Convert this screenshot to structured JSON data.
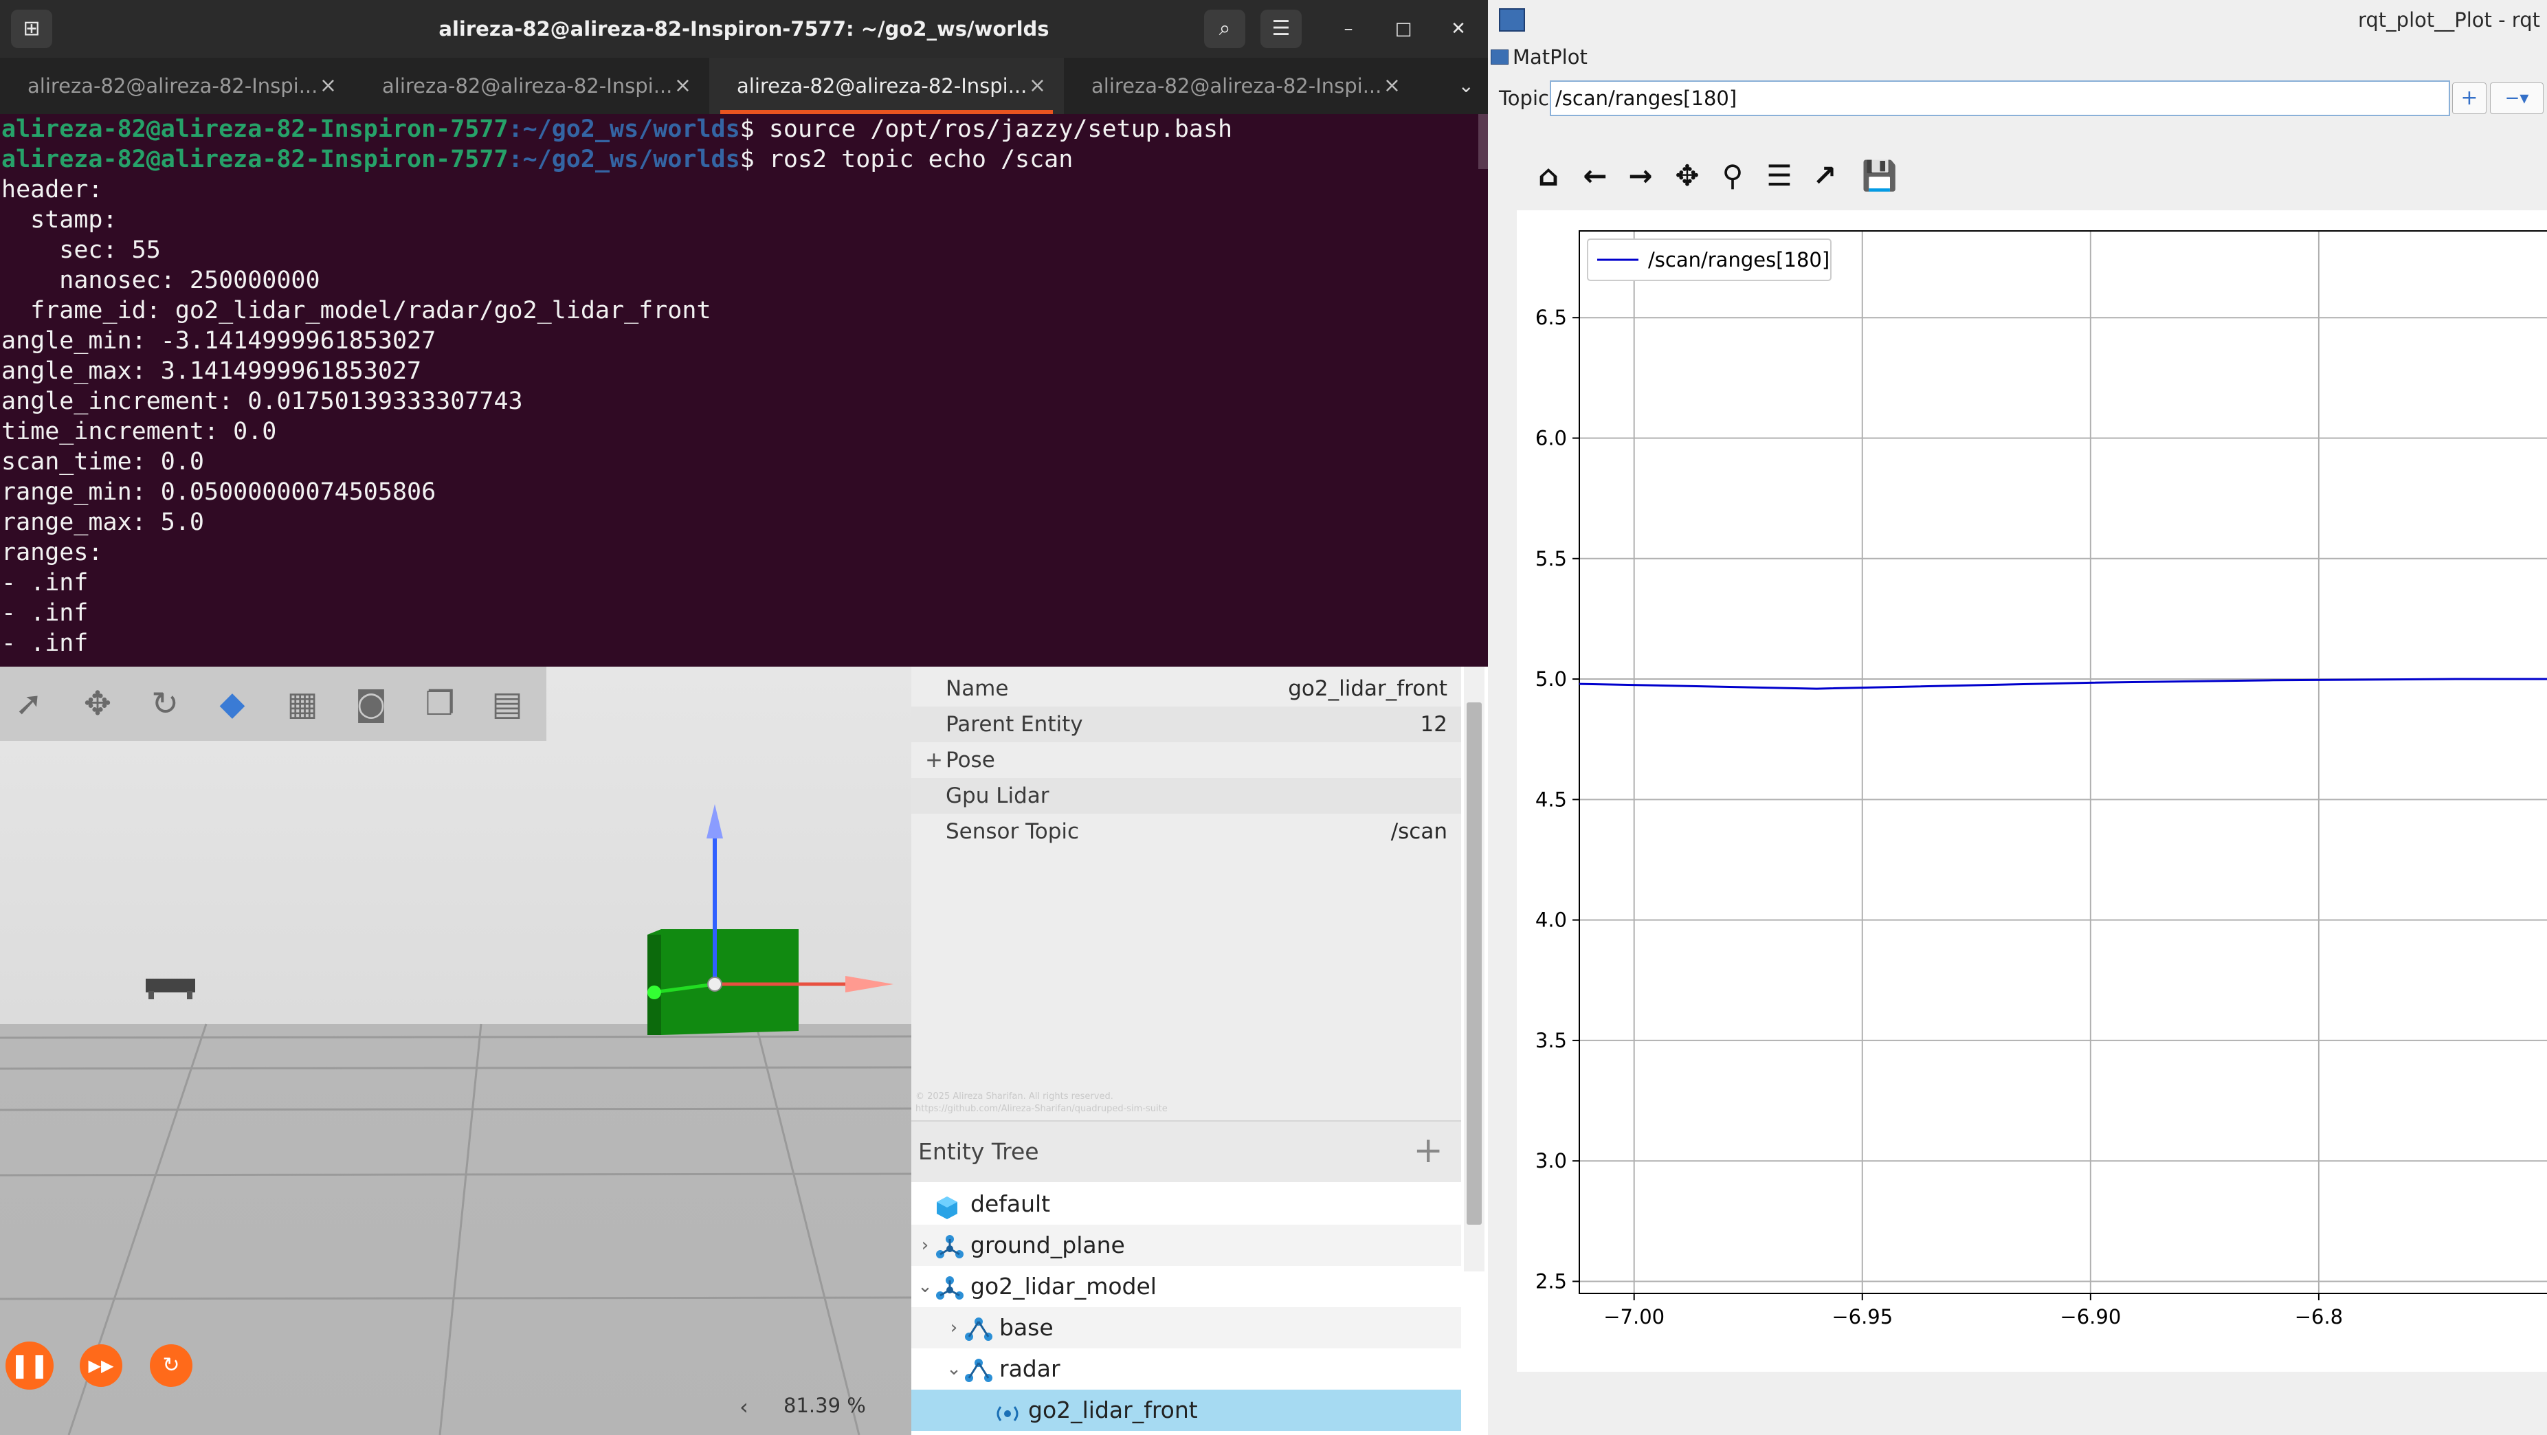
{
  "terminal": {
    "title": "alireza-82@alireza-82-Inspiron-7577: ~/go2_ws/worlds",
    "tabs": [
      {
        "label": "alireza-82@alireza-82-Inspi...",
        "active": false
      },
      {
        "label": "alireza-82@alireza-82-Inspi...",
        "active": false
      },
      {
        "label": "alireza-82@alireza-82-Inspi...",
        "active": true
      },
      {
        "label": "alireza-82@alireza-82-Inspi...",
        "active": false
      }
    ],
    "prompt_user": "alireza-82@alireza-82-Inspiron-7577",
    "prompt_path": ":~/go2_ws/worlds",
    "commands": [
      "$ source /opt/ros/jazzy/setup.bash",
      "$ ros2 topic echo /scan"
    ],
    "output_lines": [
      "header:",
      "  stamp:",
      "    sec: 55",
      "    nanosec: 250000000",
      "  frame_id: go2_lidar_model/radar/go2_lidar_front",
      "angle_min: -3.1414999961853027",
      "angle_max: 3.1414999961853027",
      "angle_increment: 0.01750139333307743",
      "time_increment: 0.0",
      "scan_time: 0.0",
      "range_min: 0.05000000074505806",
      "range_max: 5.0",
      "ranges:",
      "- .inf",
      "- .inf",
      "- .inf"
    ]
  },
  "gazebo": {
    "rtf": "81.39 %",
    "toolbar_icons": [
      "select-icon",
      "translate-icon",
      "rotate-icon",
      "transform-control-icon",
      "grid-icon",
      "screenshot-icon",
      "copy-icon",
      "paste-icon"
    ],
    "component_inspector": {
      "rows": [
        {
          "label": "Name",
          "value": "go2_lidar_front"
        },
        {
          "label": "Parent Entity",
          "value": "12"
        },
        {
          "label": "Pose",
          "value": "",
          "expandable": true
        },
        {
          "label": "Gpu Lidar",
          "value": ""
        },
        {
          "label": "Sensor Topic",
          "value": "/scan"
        }
      ],
      "watermark_1": "© 2025 Alireza Sharifan. All rights reserved.",
      "watermark_2": "https://github.com/Alireza-Sharifan/quadruped-sim-suite"
    },
    "entity_tree": {
      "title": "Entity Tree",
      "items": [
        {
          "label": "default",
          "depth": 0,
          "arrow": "",
          "icon": "world"
        },
        {
          "label": "ground_plane",
          "depth": 0,
          "arrow": "›",
          "icon": "model"
        },
        {
          "label": "go2_lidar_model",
          "depth": 0,
          "arrow": "⌄",
          "icon": "model"
        },
        {
          "label": "base",
          "depth": 1,
          "arrow": "›",
          "icon": "link"
        },
        {
          "label": "radar",
          "depth": 1,
          "arrow": "⌄",
          "icon": "link"
        },
        {
          "label": "go2_lidar_front",
          "depth": 2,
          "arrow": "",
          "icon": "sensor",
          "selected": true
        }
      ]
    }
  },
  "rqt": {
    "title": "rqt_plot__Plot - rqt",
    "plugin_label": "MatPlot",
    "topic_label": "Topic",
    "topic_value": "/scan/ranges[180]",
    "add_label": "+",
    "remove_label": "−▾",
    "toolbar_icons": [
      "home-icon",
      "back-icon",
      "forward-icon",
      "pan-icon",
      "zoom-icon",
      "configure-icon",
      "edit-axis-icon",
      "save-icon"
    ]
  },
  "chart_data": {
    "type": "line",
    "title": "",
    "xlabel": "",
    "ylabel": "",
    "xlim": [
      -7.012,
      -6.8
    ],
    "ylim": [
      2.45,
      6.86
    ],
    "x_ticks": [
      -7.0,
      -6.95,
      -6.9,
      -6.85
    ],
    "x_tick_labels": [
      "−7.00",
      "−6.95",
      "−6.90",
      "−6.8"
    ],
    "y_ticks": [
      2.5,
      3.0,
      3.5,
      4.0,
      4.5,
      5.0,
      5.5,
      6.0,
      6.5
    ],
    "y_tick_labels": [
      "2.5",
      "3.0",
      "3.5",
      "4.0",
      "4.5",
      "5.0",
      "5.5",
      "6.0",
      "6.5"
    ],
    "grid": true,
    "legend_position": "top-left",
    "series": [
      {
        "name": "/scan/ranges[180]",
        "color": "#0000cc",
        "x": [
          -7.012,
          -6.96,
          -6.9,
          -6.86,
          -6.82,
          -6.8
        ],
        "y": [
          4.98,
          4.96,
          4.985,
          4.995,
          5.0,
          5.0
        ]
      }
    ]
  }
}
